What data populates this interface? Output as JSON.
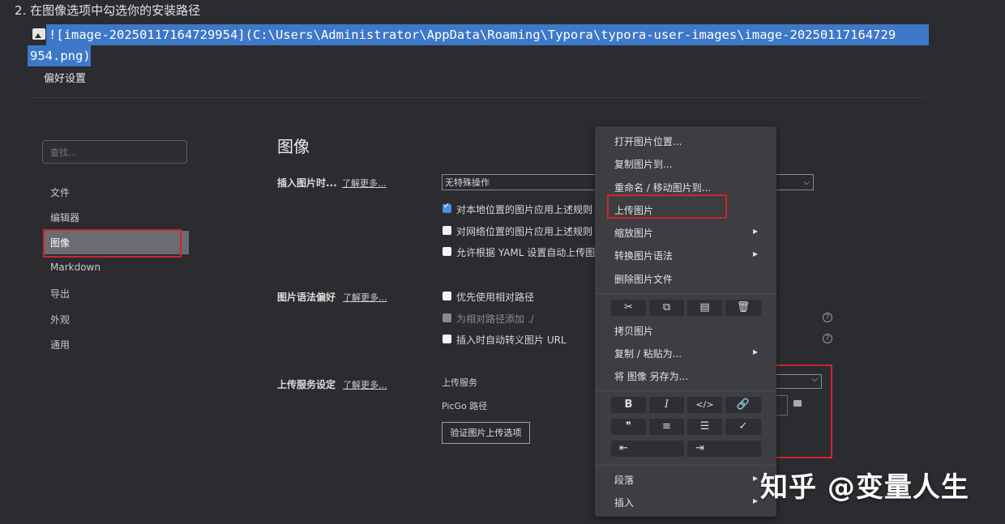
{
  "doc": {
    "step_text": "2. 在图像选项中勾选你的安装路径",
    "markdown_line1": "![image-20250117164729954](C:\\Users\\Administrator\\AppData\\Roaming\\Typora\\typora-user-images\\image-20250117164729",
    "markdown_line2": "954.png)"
  },
  "prefs": {
    "window_title": "偏好设置",
    "search_placeholder": "查找...",
    "nav": [
      "文件",
      "编辑器",
      "图像",
      "Markdown",
      "导出",
      "外观",
      "通用"
    ],
    "active_nav": "图像",
    "section_title": "图像",
    "insert": {
      "label": "插入图片时...",
      "learn_more": "了解更多...",
      "dropdown_value": "无特殊操作",
      "options": [
        {
          "label": "对本地位置的图片应用上述规则",
          "checked": true
        },
        {
          "label": "对网络位置的图片应用上述规则",
          "checked": false
        },
        {
          "label": "允许根据 YAML 设置自动上传图片",
          "checked": false
        }
      ]
    },
    "syntax": {
      "label": "图片语法偏好",
      "learn_more": "了解更多...",
      "options": [
        {
          "label": "优先使用相对路径",
          "checked": false
        },
        {
          "label": "为相对路径添加 ./",
          "checked": false,
          "disabled": true
        },
        {
          "label": "插入时自动转义图片 URL",
          "checked": false
        }
      ]
    },
    "upload": {
      "label": "上传服务设定",
      "learn_more": "了解更多...",
      "service_label": "上传服务",
      "picgo_label": "PicGo 路径",
      "verify_button": "验证图片上传选项"
    }
  },
  "context_menu": {
    "group1": [
      "打开图片位置...",
      "复制图片到...",
      "重命名 / 移动图片到...",
      "上传图片",
      "缩放图片",
      "转换图片语法",
      "删除图片文件"
    ],
    "group2": [
      "拷贝图片",
      "复制 / 粘贴为...",
      "将 图像 另存为..."
    ],
    "group3": [
      "段落",
      "插入"
    ],
    "toolbar1": [
      "cut-icon",
      "copy-icon",
      "paste-icon",
      "delete-icon"
    ],
    "format_icons": [
      "B",
      "I",
      "</>",
      "🔗",
      "❞",
      "≡",
      "☰",
      "✓",
      "⇤",
      "⇥"
    ]
  },
  "watermark": "知乎 @变量人生",
  "colors": {
    "highlight": "#d0252b",
    "selection": "#3d78c9",
    "checkbox_on": "#4b90e2"
  }
}
